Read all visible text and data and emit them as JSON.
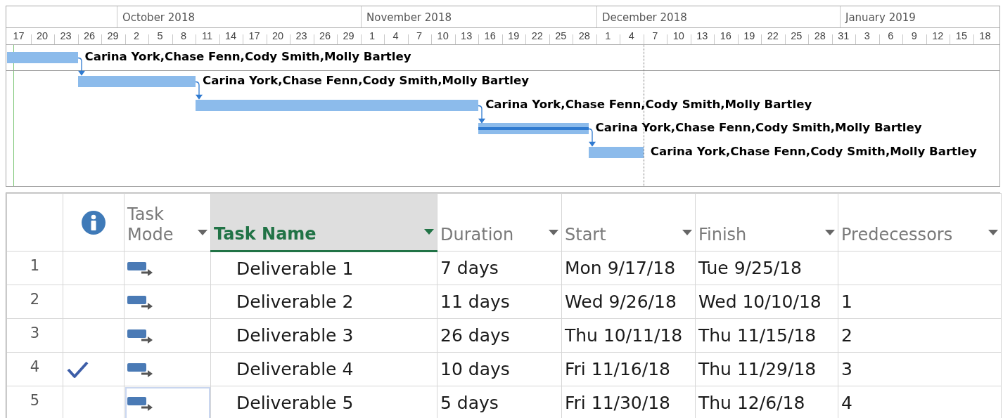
{
  "timescale": {
    "months": [
      "October 2018",
      "November 2018",
      "December 2018",
      "January 2019"
    ],
    "days": [
      "17",
      "20",
      "23",
      "26",
      "29",
      "2",
      "5",
      "8",
      "11",
      "14",
      "17",
      "20",
      "23",
      "26",
      "29",
      "1",
      "4",
      "7",
      "10",
      "13",
      "16",
      "19",
      "22",
      "25",
      "28",
      "1",
      "4",
      "7",
      "10",
      "13",
      "16",
      "19",
      "22",
      "25",
      "28",
      "31",
      "3",
      "6",
      "9",
      "12",
      "15",
      "18"
    ]
  },
  "gantt": {
    "bars": [
      {
        "resources": "Carina York,Chase Fenn,Cody Smith,Molly Bartley"
      },
      {
        "resources": "Carina York,Chase Fenn,Cody Smith,Molly Bartley"
      },
      {
        "resources": "Carina York,Chase Fenn,Cody Smith,Molly Bartley"
      },
      {
        "resources": "Carina York,Chase Fenn,Cody Smith,Molly Bartley"
      },
      {
        "resources": "Carina York,Chase Fenn,Cody Smith,Molly Bartley"
      }
    ]
  },
  "table": {
    "columns": [
      {
        "kind": "indicator",
        "selected": false
      },
      {
        "kind": "text",
        "label": "Task Mode",
        "selected": false
      },
      {
        "kind": "text",
        "label": "Task Name",
        "selected": true
      },
      {
        "kind": "text",
        "label": "Duration",
        "selected": false
      },
      {
        "kind": "text",
        "label": "Start",
        "selected": false
      },
      {
        "kind": "text",
        "label": "Finish",
        "selected": false
      },
      {
        "kind": "text",
        "label": "Predecessors",
        "selected": false
      }
    ],
    "rows": [
      {
        "id": "1",
        "complete": false,
        "name": "Deliverable 1",
        "duration": "7 days",
        "start": "Mon 9/17/18",
        "finish": "Tue 9/25/18",
        "selected": false
      },
      {
        "id": "2",
        "complete": false,
        "name": "Deliverable 2",
        "duration": "11 days",
        "start": "Wed 9/26/18",
        "finish": "Wed 10/10/18",
        "predecessors": "1",
        "selected": false
      },
      {
        "id": "3",
        "complete": false,
        "name": "Deliverable 3",
        "duration": "26 days",
        "start": "Thu 10/11/18",
        "finish": "Thu 11/15/18",
        "predecessors": "2",
        "selected": false
      },
      {
        "id": "4",
        "complete": true,
        "name": "Deliverable 4",
        "duration": "10 days",
        "start": "Fri 11/16/18",
        "finish": "Thu 11/29/18",
        "predecessors": "3",
        "selected": false
      },
      {
        "id": "5",
        "complete": false,
        "name": "Deliverable 5",
        "duration": "5 days",
        "start": "Fri 11/30/18",
        "finish": "Thu 12/6/18",
        "predecessors": "4",
        "selected": true
      }
    ]
  }
}
